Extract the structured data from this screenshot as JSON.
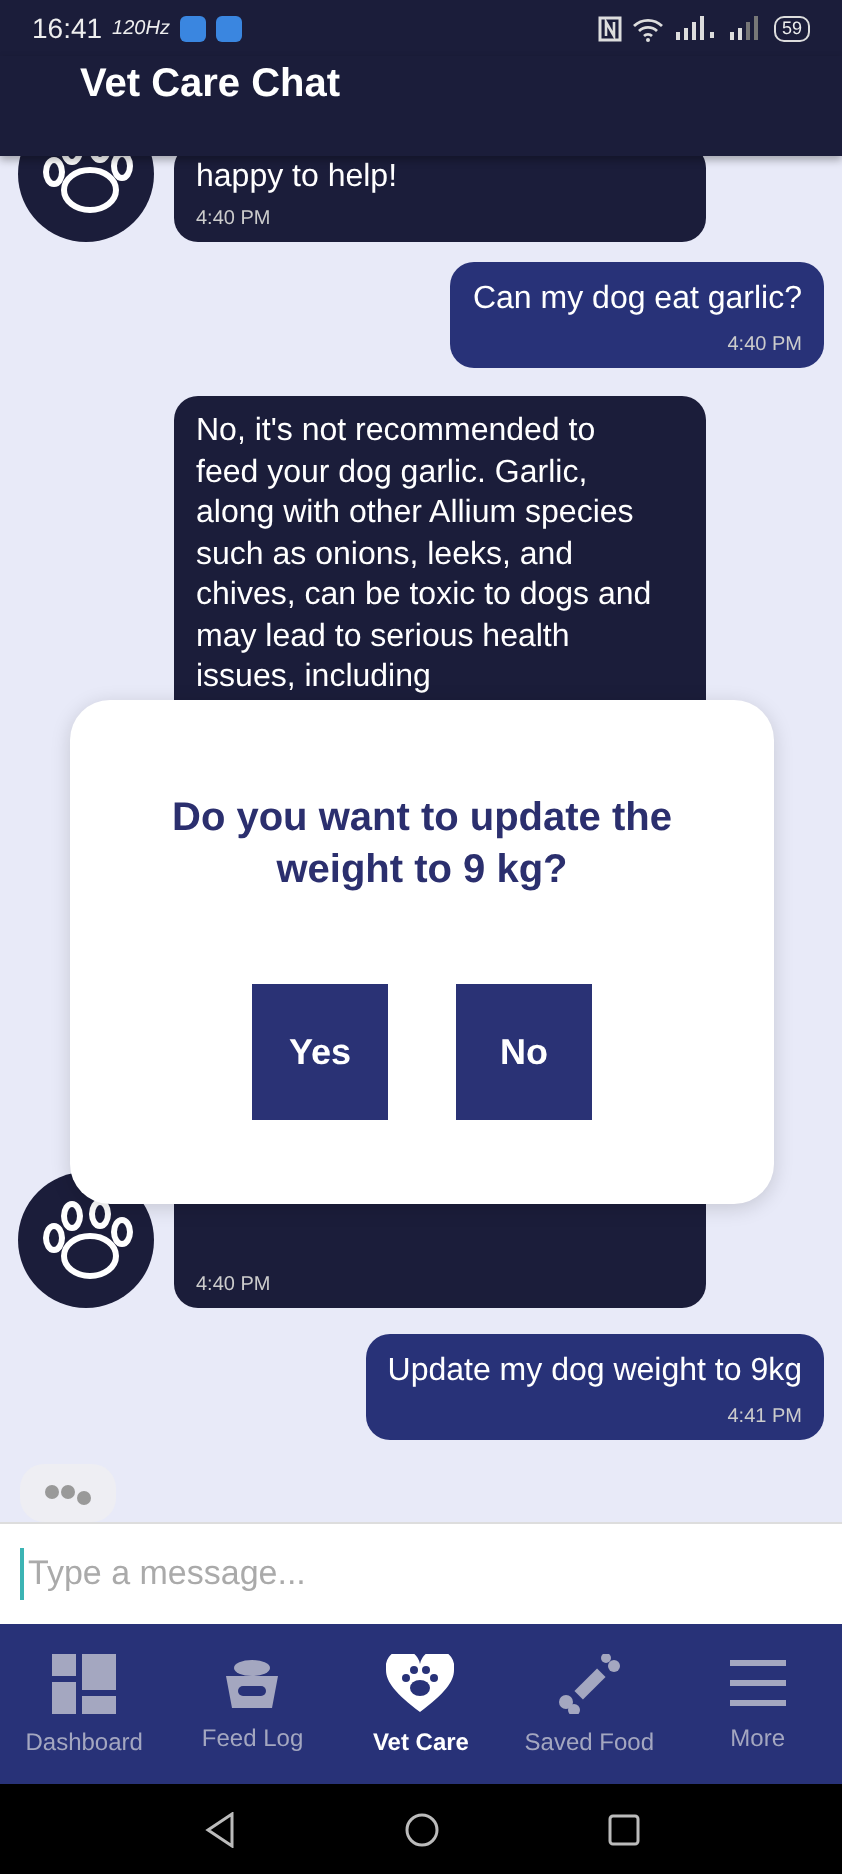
{
  "status_bar": {
    "time": "16:41",
    "refresh_rate": "120Hz",
    "battery": "59"
  },
  "header": {
    "title": "Vet Care Chat"
  },
  "messages": [
    {
      "kind": "bot",
      "text": "happy to help!",
      "time": "4:40 PM"
    },
    {
      "kind": "user",
      "text": "Can my dog eat garlic?",
      "time": "4:40 PM"
    },
    {
      "kind": "bot",
      "text": "No, it's not recommended to feed your dog garlic. Garlic, along with other Allium species such as onions, leeks, and chives, can be toxic to dogs and may lead to serious health issues, including"
    },
    {
      "kind": "bot",
      "time": "4:40 PM"
    },
    {
      "kind": "user",
      "text": "Update my dog weight to 9kg",
      "time": "4:41 PM"
    }
  ],
  "typing_indicator": true,
  "input": {
    "placeholder": "Type a message..."
  },
  "dialog": {
    "question": "Do you want to update the weight to 9 kg?",
    "buttons": [
      "Yes",
      "No"
    ]
  },
  "nav": [
    {
      "label": "Dashboard",
      "selected": false
    },
    {
      "label": "Feed Log",
      "selected": false
    },
    {
      "label": "Vet Care",
      "selected": true
    },
    {
      "label": "Saved Food",
      "selected": false
    },
    {
      "label": "More",
      "selected": false
    }
  ]
}
